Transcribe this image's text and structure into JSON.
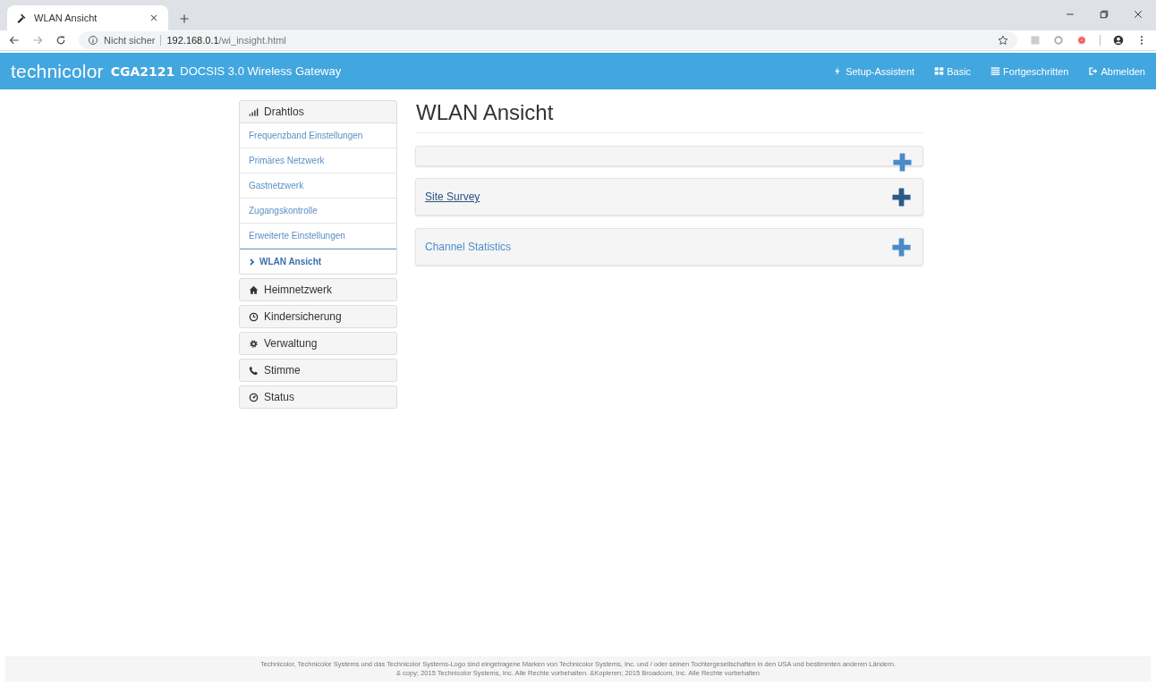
{
  "browser": {
    "tab_title": "WLAN Ansicht",
    "security": "Nicht sicher",
    "url_host": "192.168.0.1",
    "url_path": "/wi_insight.html"
  },
  "header": {
    "brand": "technicolor",
    "model": "CGA2121",
    "product": "DOCSIS 3.0 Wireless Gateway",
    "nav": [
      {
        "label": "Setup-Assistent"
      },
      {
        "label": "Basic"
      },
      {
        "label": "Fortgeschritten"
      },
      {
        "label": "Abmelden"
      }
    ]
  },
  "sidebar": [
    {
      "label": "Drahtlos",
      "expanded": true,
      "children": [
        {
          "label": "Frequenzband Einstellungen",
          "selected": false
        },
        {
          "label": "Primäres Netzwerk",
          "selected": false
        },
        {
          "label": "Gastnetzwerk",
          "selected": false
        },
        {
          "label": "Zugangskontrolle",
          "selected": false
        },
        {
          "label": "Erweiterte Einstellungen",
          "selected": false
        },
        {
          "label": "WLAN Ansicht",
          "selected": true
        }
      ]
    },
    {
      "label": "Heimnetzwerk",
      "expanded": false
    },
    {
      "label": "Kindersicherung",
      "expanded": false
    },
    {
      "label": "Verwaltung",
      "expanded": false
    },
    {
      "label": "Stimme",
      "expanded": false
    },
    {
      "label": "Status",
      "expanded": false
    }
  ],
  "page_title": "WLAN Ansicht",
  "panels": [
    {
      "kind": "empty",
      "hovered": false
    },
    {
      "kind": "titled",
      "title": "Site Survey",
      "hovered": true
    },
    {
      "kind": "titled",
      "title": "Channel Statistics",
      "hovered": false
    }
  ],
  "footer": [
    "Technicolor, Technicolor Systems und das Technicolor Systems-Logo sind eingetragene Marken von Technicolor Systems, Inc. und / oder seinen Tochtergesellschaften in den USA und bestimmten anderen Ländern.",
    "& copy; 2015 Technicolor Systems, Inc. Alle Rechte vorbehalten. &Kopieren; 2015 Broadcom, Inc. Alle Rechte vorbehalten"
  ]
}
